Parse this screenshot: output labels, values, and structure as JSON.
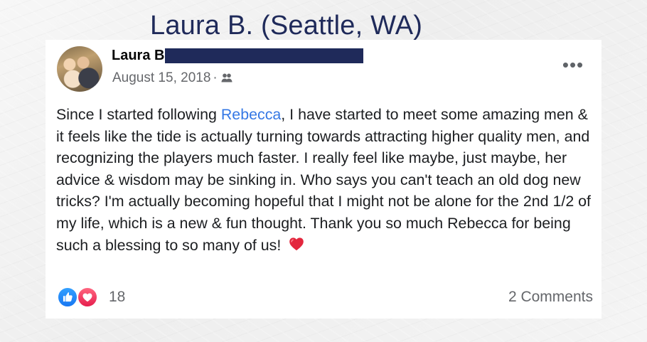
{
  "headline": "Laura B. (Seattle, WA)",
  "post": {
    "author": "Laura B",
    "date": "August 15, 2018",
    "separator": "·",
    "privacy_icon": "friends-icon",
    "more_label": "•••",
    "text": {
      "before_mention": "Since I started following ",
      "mention": "Rebecca",
      "after_mention": ", I have started to meet some amazing men & it feels like the tide is actually turning towards attracting higher quality men, and recognizing the players much faster. I really feel like maybe, just maybe, her advice & wisdom may be sinking in. Who says you can't teach an old dog new tricks? I'm actually becoming hopeful that I might not be alone for the 2nd 1/2 of my life, which is a new & fun thought. Thank you so much Rebecca for being such a blessing to so many of us!"
    },
    "emoji": "heart-emoji",
    "reactions": {
      "icons": [
        "like-icon",
        "love-icon"
      ],
      "count": "18"
    },
    "comments_label": "2 Comments"
  },
  "colors": {
    "headline": "#1f2a5a",
    "redaction": "#1f2a5a",
    "mention": "#3578e5",
    "like": "#1877f2",
    "love": "#e61e4d",
    "meta": "#65676b"
  }
}
